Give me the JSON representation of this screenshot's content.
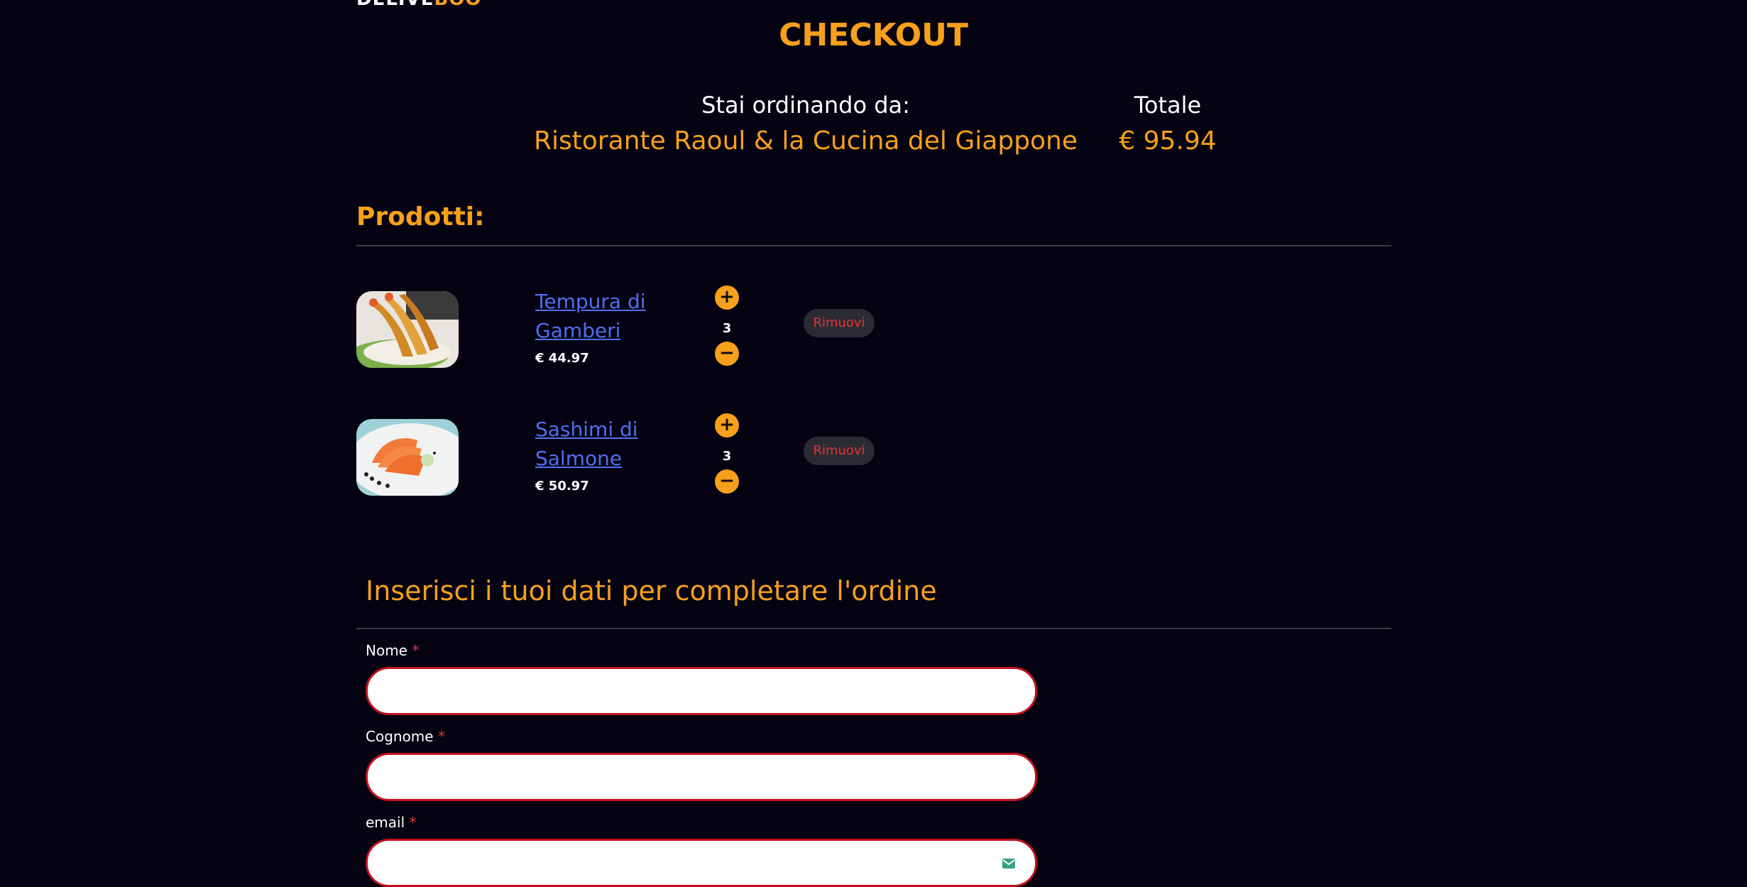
{
  "brand": {
    "part1": "DELIVE",
    "part2": "BOO"
  },
  "page_title": "CHECKOUT",
  "order": {
    "from_label": "Stai ordinando da:",
    "restaurant": "Ristorante Raoul & la Cucina del Giappone",
    "total_label": "Totale",
    "total_value": "€ 95.94"
  },
  "products_heading": "Prodotti:",
  "products": [
    {
      "name": "Tempura di Gamberi",
      "price": "€ 44.97",
      "quantity": "3",
      "plus": "+",
      "minus": "−",
      "remove_label": "Rimuovi"
    },
    {
      "name": "Sashimi di Salmone",
      "price": "€ 50.97",
      "quantity": "3",
      "plus": "+",
      "minus": "−",
      "remove_label": "Rimuovi"
    }
  ],
  "form": {
    "heading": "Inserisci i tuoi dati per completare l'ordine",
    "required_mark": "*",
    "fields": [
      {
        "label": "Nome",
        "value": ""
      },
      {
        "label": "Cognome",
        "value": ""
      },
      {
        "label": "email",
        "value": ""
      }
    ]
  },
  "colors": {
    "background": "#050312",
    "accent": "#f7a01c",
    "link": "#4f6ef0",
    "danger": "#e53535",
    "field_border": "#c1121f"
  }
}
